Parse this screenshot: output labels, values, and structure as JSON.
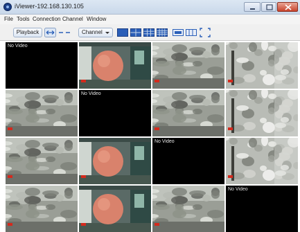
{
  "window": {
    "title": "iViewer-192.168.130.105"
  },
  "menu": [
    {
      "id": "file",
      "label": "File"
    },
    {
      "id": "tools",
      "label": "Tools"
    },
    {
      "id": "connection",
      "label": "Connection"
    },
    {
      "id": "channel",
      "label": "Channel"
    },
    {
      "id": "window",
      "label": "Window"
    }
  ],
  "toolbar": {
    "playback_label": "Playback",
    "channel_label": "Channel"
  },
  "colors": {
    "accent_blue": "#2b5fb8",
    "no_video_bg": "#000000",
    "close_red": "#c8432c"
  },
  "grid": {
    "rows": 4,
    "cols": 4,
    "no_video_text": "No Video",
    "cells": [
      {
        "kind": "none"
      },
      {
        "kind": "door"
      },
      {
        "kind": "street"
      },
      {
        "kind": "tree"
      },
      {
        "kind": "street"
      },
      {
        "kind": "none"
      },
      {
        "kind": "street"
      },
      {
        "kind": "tree"
      },
      {
        "kind": "street"
      },
      {
        "kind": "door"
      },
      {
        "kind": "none"
      },
      {
        "kind": "tree"
      },
      {
        "kind": "street"
      },
      {
        "kind": "door"
      },
      {
        "kind": "street"
      },
      {
        "kind": "none"
      }
    ]
  }
}
